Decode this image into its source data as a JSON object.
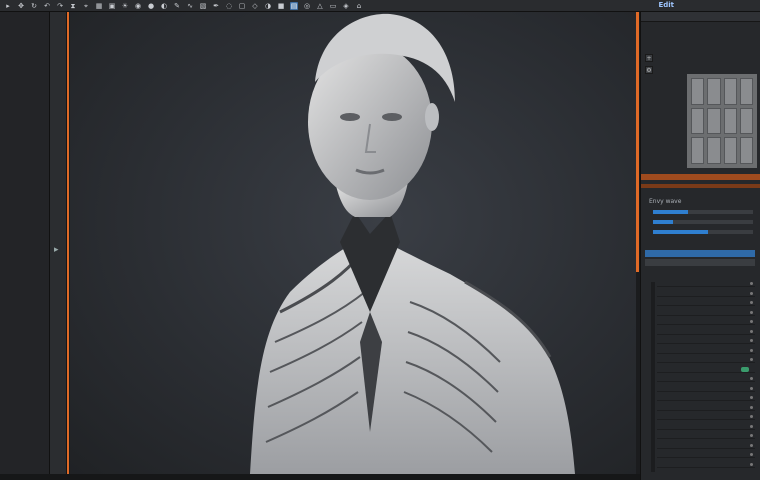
{
  "toolbar": {
    "icons": [
      "select",
      "move",
      "rotate",
      "undo",
      "redo",
      "history",
      "snap",
      "grid",
      "camera",
      "light",
      "render",
      "material",
      "sculpt",
      "brush",
      "smooth",
      "mask",
      "paint",
      "hide",
      "display",
      "wire",
      "shade",
      "solid",
      "texture",
      "view",
      "persp",
      "frame",
      "isolate",
      "scene"
    ],
    "app_logo_text": "Edit"
  },
  "left_panel": {
    "rows": [
      "",
      "",
      "",
      "",
      "",
      "",
      "",
      "",
      "",
      ""
    ]
  },
  "viewport": {
    "subject": "sculpted-figure"
  },
  "right_panel": {
    "header_label": "",
    "details_label": "Envy wave",
    "rows_top": [
      "",
      "",
      "",
      "",
      "",
      ""
    ],
    "list_rows": [
      "",
      "",
      "",
      "",
      "",
      "",
      "",
      "",
      "",
      "",
      "",
      "",
      "",
      "",
      "",
      "",
      "",
      "",
      "",
      ""
    ]
  },
  "colors": {
    "accent_orange": "#e06a27",
    "selection_blue": "#2f6aa8",
    "panel_bg": "#26282b",
    "viewport_bg": "#2b2e33"
  }
}
